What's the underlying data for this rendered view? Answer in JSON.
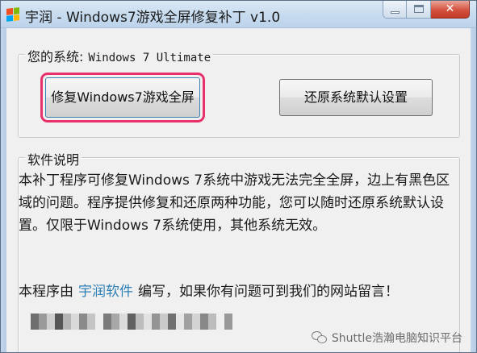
{
  "window": {
    "title": "宇润 - Windows7游戏全屏修复补丁 v1.0",
    "close_glyph": "✕"
  },
  "system_group": {
    "label": "您的系统:",
    "value": "Windows 7 Ultimate"
  },
  "buttons": {
    "fix_label": "修复Windows7游戏全屏",
    "restore_label": "还原系统默认设置"
  },
  "description_group": {
    "title": "软件说明",
    "body": "本补丁程序可修复Windows 7系统中游戏无法完全全屏，边上有黑色区域的问题。程序提供修复和还原两种功能，您可以随时还原系统默认设置。仅限于Windows 7系统使用，其他系统无效。",
    "credit_prefix": "本程序由",
    "credit_link": "宇润软件",
    "credit_suffix": "编写，如果你有问题可到我们的网站留言！"
  },
  "mosaic_colors": [
    "#6e6e6e",
    "#9a9a9a",
    "#cfcfcf",
    "#555555",
    "#b5b5b5",
    "#d9d9d9",
    "#8a8a8a",
    "#c4c4c4",
    "#eeeeee",
    "#7b7b7b",
    "#a8a8a8",
    "#dcdcdc",
    "#616161",
    "#bdbdbd",
    "#e2e2e2",
    "#949494",
    "#cacaca",
    "#707070",
    "#e6e6e6",
    "#a1a1a1",
    "#d3d3d3",
    "#888888",
    "#bcbcbc",
    "#efefef",
    "#999999"
  ],
  "watermark": {
    "text": "Shuttle浩瀚电脑知识平台"
  }
}
